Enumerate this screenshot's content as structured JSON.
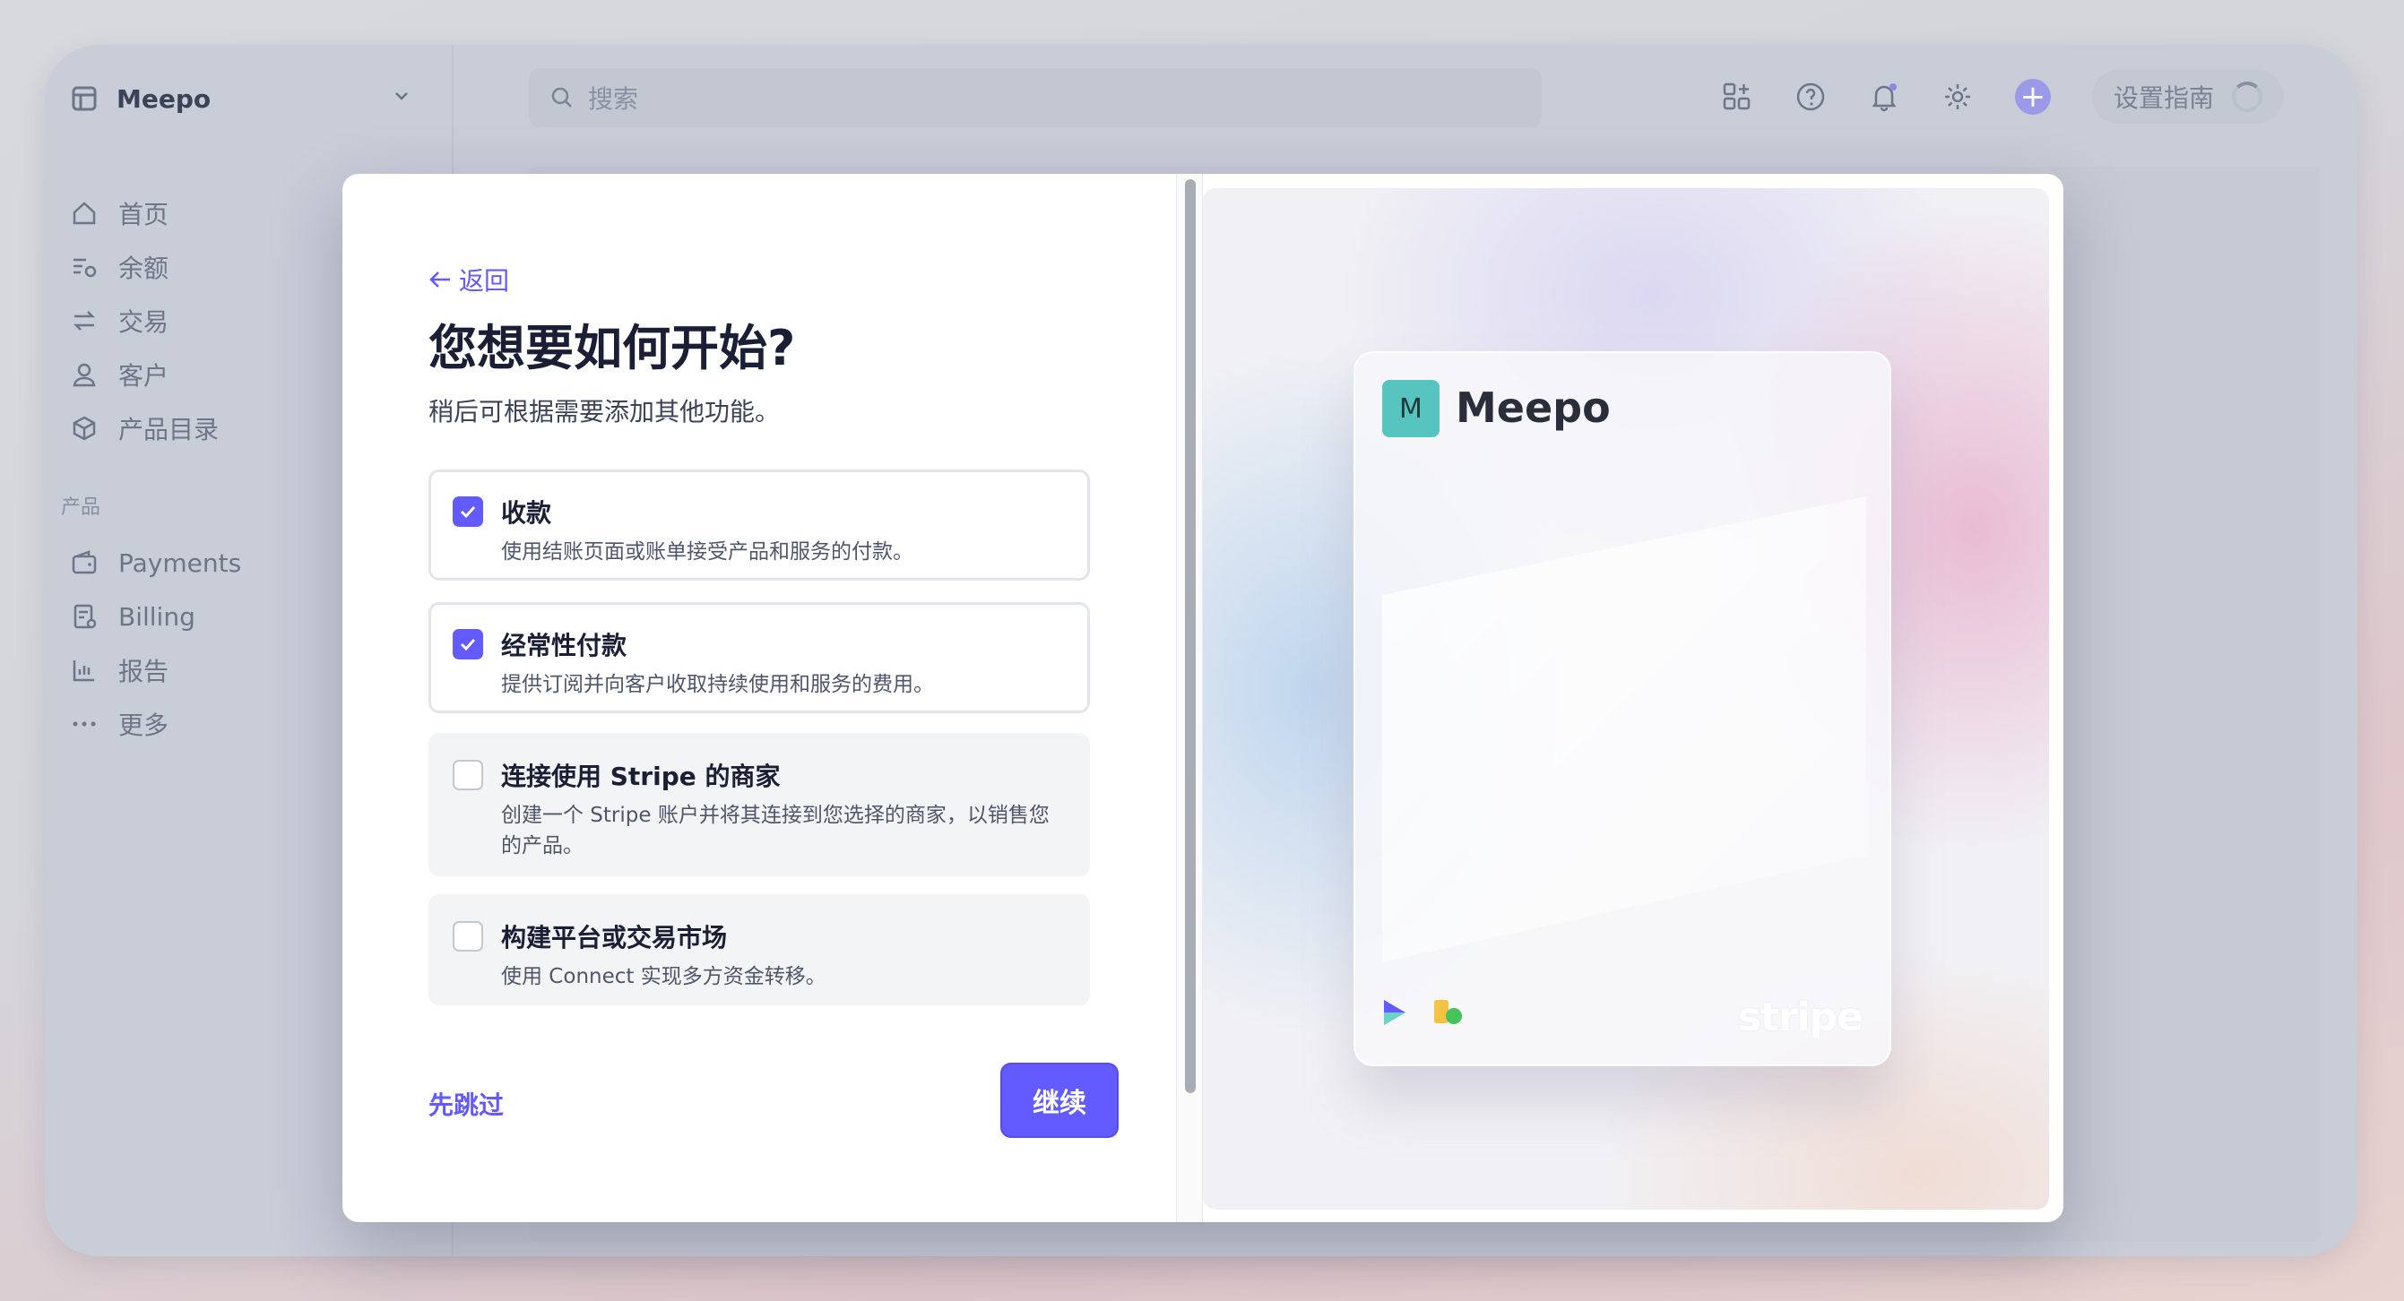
{
  "account": {
    "name": "Meepo"
  },
  "sidebar": {
    "items": [
      {
        "label": "首页",
        "icon": "home-icon"
      },
      {
        "label": "余额",
        "icon": "balance-icon"
      },
      {
        "label": "交易",
        "icon": "transactions-icon"
      },
      {
        "label": "客户",
        "icon": "customer-icon"
      },
      {
        "label": "产品目录",
        "icon": "product-catalog-icon"
      }
    ],
    "section_label": "产品",
    "product_items": [
      {
        "label": "Payments",
        "icon": "wallet-icon"
      },
      {
        "label": "Billing",
        "icon": "billing-icon"
      },
      {
        "label": "报告",
        "icon": "reports-icon"
      },
      {
        "label": "更多",
        "icon": "more-icon"
      }
    ]
  },
  "search": {
    "placeholder": "搜索"
  },
  "toolbar": {
    "guide_label": "设置指南"
  },
  "modal": {
    "back_label": "返回",
    "title": "您想要如何开始?",
    "subtitle": "稍后可根据需要添加其他功能。",
    "options": [
      {
        "title": "收款",
        "desc": "使用结账页面或账单接受产品和服务的付款。",
        "checked": true
      },
      {
        "title": "经常性付款",
        "desc": "提供订阅并向客户收取持续使用和服务的费用。",
        "checked": true
      },
      {
        "title": "连接使用 Stripe 的商家",
        "desc": "创建一个 Stripe 账户并将其连接到您选择的商家，以销售您的产品。",
        "checked": false
      },
      {
        "title": "构建平台或交易市场",
        "desc": "使用 Connect 实现多方资金转移。",
        "checked": false
      }
    ],
    "skip_label": "先跳过",
    "continue_label": "继续"
  },
  "preview": {
    "logo_letter": "M",
    "business_name": "Meepo",
    "brand": "stripe"
  },
  "colors": {
    "accent": "#635bff",
    "logo_bg": "#58c4c0"
  }
}
